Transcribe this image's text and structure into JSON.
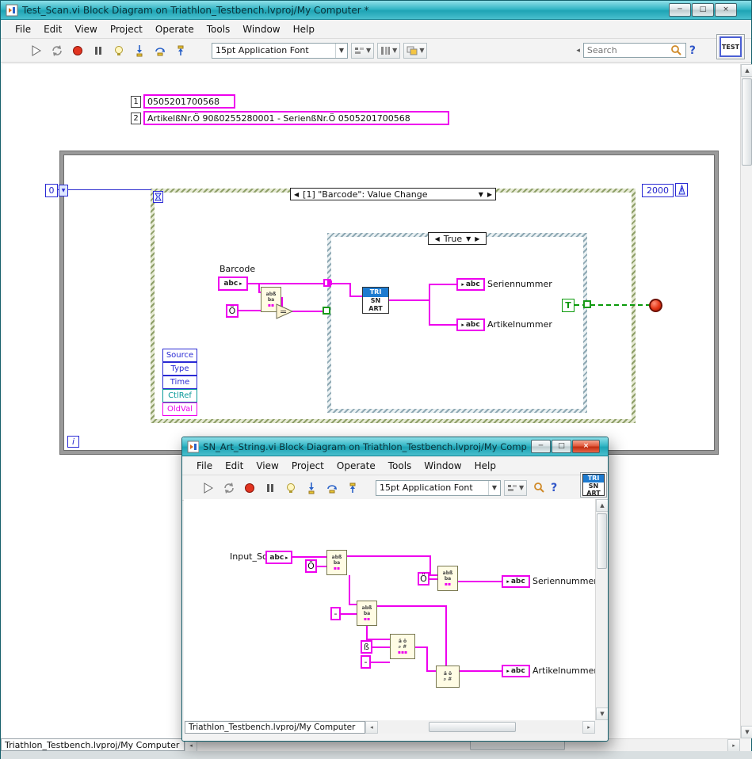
{
  "colors": {
    "titlebar_teal": "#2eb4c4",
    "wire_magenta": "#ee00ee",
    "numeric_blue": "#2a2ad4",
    "boolean_green": "#0a9a0a",
    "stop_red": "#e63616"
  },
  "glyphs": {
    "minimize": "─",
    "maximize": "□",
    "close": "×",
    "scroll_up": "▲",
    "scroll_down": "▼",
    "scroll_left": "◂",
    "scroll_right": "▸",
    "header_left": "◀",
    "header_right": "▶",
    "dropdown": "▼",
    "help": "?",
    "arrow_out": "▸"
  },
  "main_window": {
    "title": "Test_Scan.vi Block Diagram on Triathlon_Testbench.lvproj/My Computer *",
    "menu": [
      "File",
      "Edit",
      "View",
      "Project",
      "Operate",
      "Tools",
      "Window",
      "Help"
    ],
    "toolbar": {
      "font_selector": "15pt Application Font",
      "search_placeholder": "Search"
    },
    "vi_icon_text": "TEST",
    "status_path": "Triathlon_Testbench.lvproj/My Computer",
    "canvas": {
      "const1_index": "1",
      "const1": "0505201700568",
      "const2_index": "2",
      "const2": "ArtikelßNr.Ö 90ß0255280001 - SerienßNr.Ö 0505201700568",
      "timeout_const": "0",
      "ms_const": "2000",
      "event_header": "[1] \"Barcode\": Value Change",
      "case_selector": "True",
      "barcode_label": "Barcode",
      "abc": "abc",
      "o_const": "Ö",
      "equals": "=",
      "subvi": {
        "top": "TRI",
        "mid": "SN",
        "bottom": "ART"
      },
      "serien_label": "Seriennummer",
      "artikel_label": "Artikelnummer",
      "event_fields": [
        "Source",
        "Type",
        "Time",
        "CtlRef",
        "OldVal"
      ],
      "true_const": "T",
      "iteration": "i"
    }
  },
  "sub_window": {
    "title": "SN_Art_String.vi Block Diagram on Triathlon_Testbench.lvproj/My Computer",
    "menu": [
      "File",
      "Edit",
      "View",
      "Project",
      "Operate",
      "Tools",
      "Window",
      "Help"
    ],
    "toolbar": {
      "font_selector": "15pt Application Font"
    },
    "vi_icon": {
      "top": "TRI",
      "mid": "SN",
      "bottom": "ART"
    },
    "status_path": "Triathlon_Testbench.lvproj/My Computer",
    "canvas": {
      "input_label": "Input_Scan",
      "abc": "abc",
      "o_const_1": "Ö",
      "o_const_2": "Ö",
      "dash_const_1": "-",
      "sz_const": "ß",
      "dash_const_2": "-",
      "serien_label": "Seriennummer",
      "artikel_label": "Artikelnummer"
    }
  }
}
